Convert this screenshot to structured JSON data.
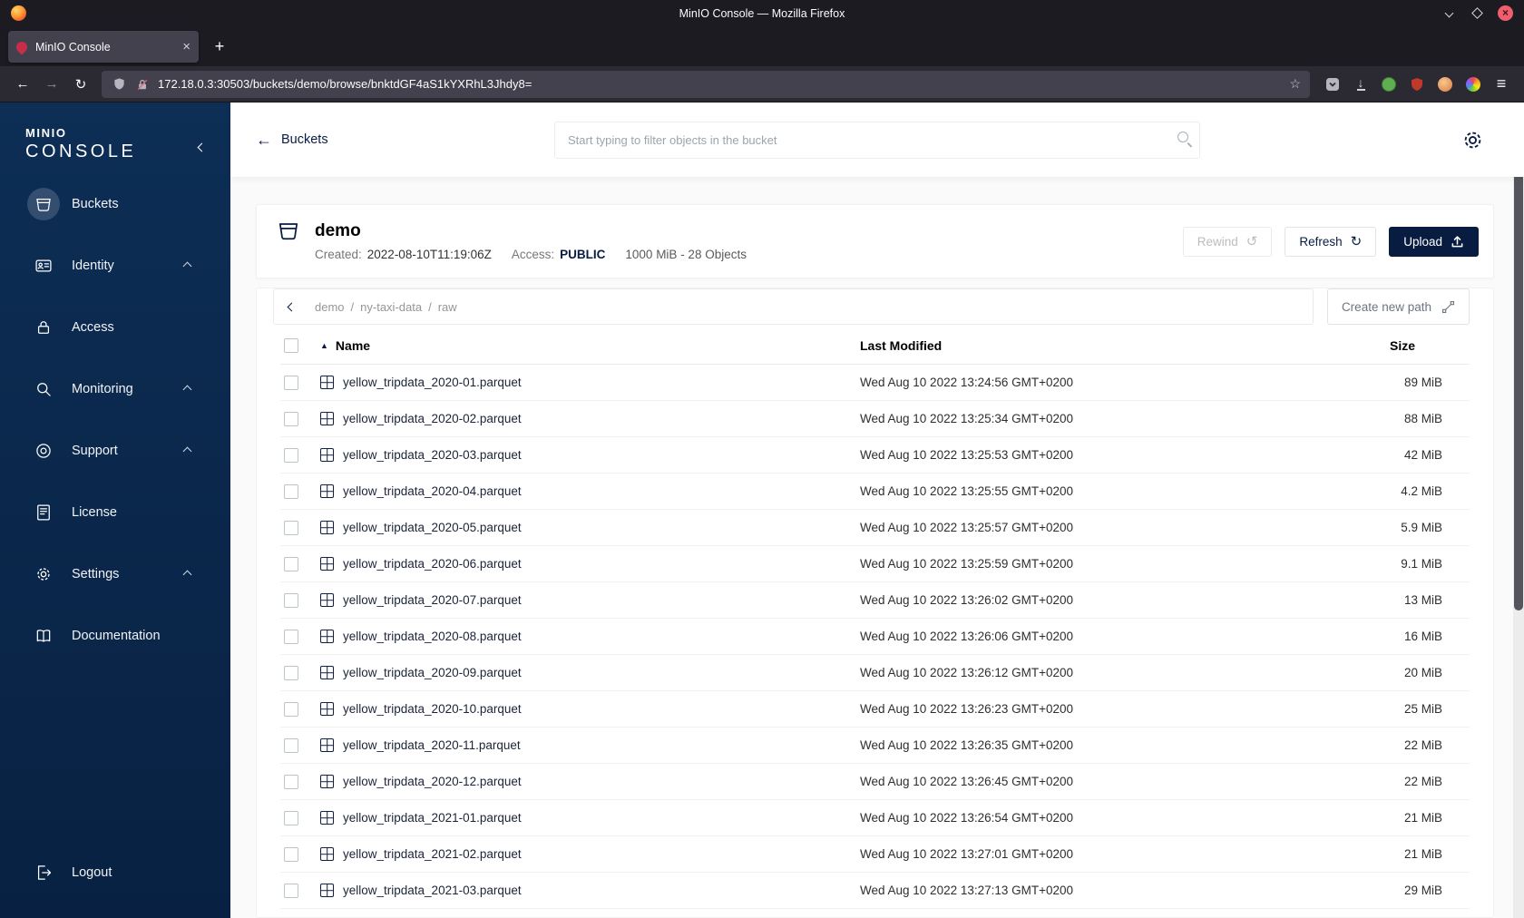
{
  "window": {
    "title": "MinIO Console — Mozilla Firefox"
  },
  "browser": {
    "tab_title": "MinIO Console",
    "url": "172.18.0.3:30503/buckets/demo/browse/bnktdGF4aS1kYXRhL3Jhdy8="
  },
  "icons": {
    "close": "×",
    "plus": "+",
    "back_arrow": "←",
    "forward_arrow": "→",
    "reload": "↻",
    "rewind": "↺",
    "star": "☆",
    "download": "↓",
    "hamburger": "≡",
    "sort_asc": "▲",
    "slash": "/"
  },
  "sidebar": {
    "logo_top": "MINIO",
    "logo_bottom": "CONSOLE",
    "items": [
      {
        "label": "Buckets"
      },
      {
        "label": "Identity"
      },
      {
        "label": "Access"
      },
      {
        "label": "Monitoring"
      },
      {
        "label": "Support"
      },
      {
        "label": "License"
      },
      {
        "label": "Settings"
      },
      {
        "label": "Documentation"
      }
    ],
    "logout_label": "Logout"
  },
  "header": {
    "back_label": "Buckets",
    "search_placeholder": "Start typing to filter objects in the bucket"
  },
  "bucket": {
    "name": "demo",
    "created_label": "Created:",
    "created_value": "2022-08-10T11:19:06Z",
    "access_label": "Access:",
    "access_value": "PUBLIC",
    "usage": "1000 MiB - 28 Objects",
    "rewind_label": "Rewind",
    "refresh_label": "Refresh",
    "upload_label": "Upload"
  },
  "browse": {
    "path_segments": [
      "demo",
      "ny-taxi-data",
      "raw"
    ],
    "create_path_label": "Create new path"
  },
  "table": {
    "col_name": "Name",
    "col_modified": "Last Modified",
    "col_size": "Size",
    "rows": [
      {
        "name": "yellow_tripdata_2020-01.parquet",
        "modified": "Wed Aug 10 2022 13:24:56 GMT+0200",
        "size": "89 MiB"
      },
      {
        "name": "yellow_tripdata_2020-02.parquet",
        "modified": "Wed Aug 10 2022 13:25:34 GMT+0200",
        "size": "88 MiB"
      },
      {
        "name": "yellow_tripdata_2020-03.parquet",
        "modified": "Wed Aug 10 2022 13:25:53 GMT+0200",
        "size": "42 MiB"
      },
      {
        "name": "yellow_tripdata_2020-04.parquet",
        "modified": "Wed Aug 10 2022 13:25:55 GMT+0200",
        "size": "4.2 MiB"
      },
      {
        "name": "yellow_tripdata_2020-05.parquet",
        "modified": "Wed Aug 10 2022 13:25:57 GMT+0200",
        "size": "5.9 MiB"
      },
      {
        "name": "yellow_tripdata_2020-06.parquet",
        "modified": "Wed Aug 10 2022 13:25:59 GMT+0200",
        "size": "9.1 MiB"
      },
      {
        "name": "yellow_tripdata_2020-07.parquet",
        "modified": "Wed Aug 10 2022 13:26:02 GMT+0200",
        "size": "13 MiB"
      },
      {
        "name": "yellow_tripdata_2020-08.parquet",
        "modified": "Wed Aug 10 2022 13:26:06 GMT+0200",
        "size": "16 MiB"
      },
      {
        "name": "yellow_tripdata_2020-09.parquet",
        "modified": "Wed Aug 10 2022 13:26:12 GMT+0200",
        "size": "20 MiB"
      },
      {
        "name": "yellow_tripdata_2020-10.parquet",
        "modified": "Wed Aug 10 2022 13:26:23 GMT+0200",
        "size": "25 MiB"
      },
      {
        "name": "yellow_tripdata_2020-11.parquet",
        "modified": "Wed Aug 10 2022 13:26:35 GMT+0200",
        "size": "22 MiB"
      },
      {
        "name": "yellow_tripdata_2020-12.parquet",
        "modified": "Wed Aug 10 2022 13:26:45 GMT+0200",
        "size": "22 MiB"
      },
      {
        "name": "yellow_tripdata_2021-01.parquet",
        "modified": "Wed Aug 10 2022 13:26:54 GMT+0200",
        "size": "21 MiB"
      },
      {
        "name": "yellow_tripdata_2021-02.parquet",
        "modified": "Wed Aug 10 2022 13:27:01 GMT+0200",
        "size": "21 MiB"
      },
      {
        "name": "yellow_tripdata_2021-03.parquet",
        "modified": "Wed Aug 10 2022 13:27:13 GMT+0200",
        "size": "29 MiB"
      }
    ]
  },
  "colors": {
    "accent_navy": "#081C42",
    "sidebar_navy": "#0B2B4E",
    "minio_red": "#C72E49"
  }
}
